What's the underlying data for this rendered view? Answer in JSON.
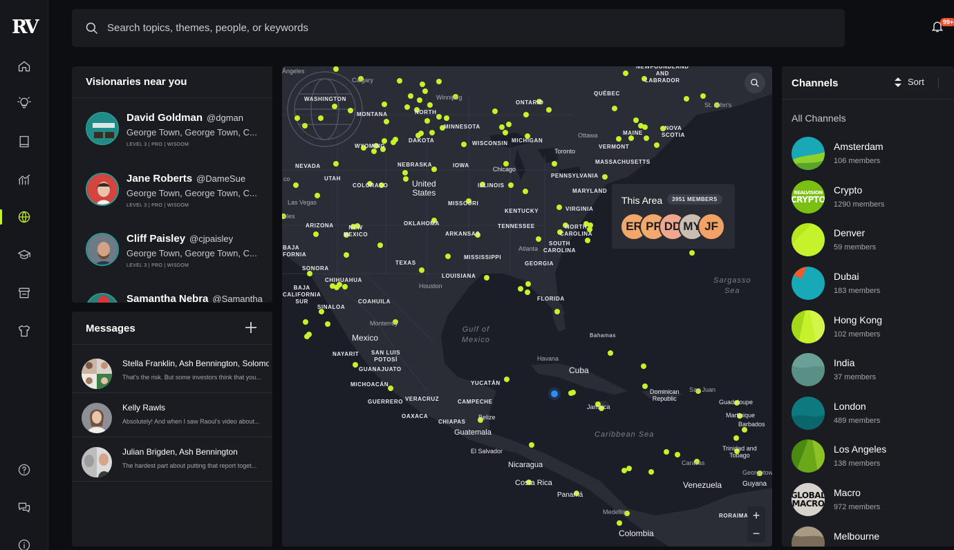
{
  "app": {
    "logo": "RV",
    "nav": [
      {
        "name": "nav-home",
        "icon": "home-icon"
      },
      {
        "name": "nav-ideas",
        "icon": "lightbulb-icon"
      },
      {
        "name": "nav-library",
        "icon": "book-icon"
      },
      {
        "name": "nav-charts",
        "icon": "chart-icon"
      },
      {
        "name": "nav-explore",
        "icon": "globe-icon",
        "active": true
      },
      {
        "name": "nav-academy",
        "icon": "graduation-cap-icon"
      },
      {
        "name": "nav-store",
        "icon": "store-icon"
      },
      {
        "name": "nav-merch",
        "icon": "tshirt-icon"
      },
      {
        "name": "nav-help",
        "icon": "question-icon"
      },
      {
        "name": "nav-chat",
        "icon": "chat-bubbles-icon"
      },
      {
        "name": "nav-info",
        "icon": "info-icon"
      }
    ],
    "accent": "#c5f22b"
  },
  "search": {
    "placeholder": "Search topics, themes, people, or keywords"
  },
  "notifications": {
    "badge": "99+"
  },
  "visionaries": {
    "title": "Visionaries near you",
    "people": [
      {
        "name": "David Goldman",
        "handle": "@dgman",
        "location": "George Town, George Town, C...",
        "meta": "LEVEL 3 | PRO | WISDOM"
      },
      {
        "name": "Jane Roberts",
        "handle": "@DameSue",
        "location": "George Town, George Town, C...",
        "meta": "LEVEL 3 | PRO | WISDOM"
      },
      {
        "name": "Cliff Paisley",
        "handle": "@cjpaisley",
        "location": "George Town, George Town, C...",
        "meta": "LEVEL 3 | PRO | WISDOM"
      },
      {
        "name": "Samantha Nebra",
        "handle": "@Samantha",
        "location": "",
        "meta": ""
      }
    ]
  },
  "messages": {
    "title": "Messages",
    "items": [
      {
        "names": "Stella Franklin, Ash Bennington, Solomon",
        "preview": "That's the risk. But some investors think that you..."
      },
      {
        "names": "Kelly Rawls",
        "preview": "Absolutely! And when I saw Raoul's video about..."
      },
      {
        "names": "Julian Brigden, Ash Bennington",
        "preview": "The hardest part about putting that report toget..."
      }
    ]
  },
  "map": {
    "area_card": {
      "title": "This Area",
      "members": "3951 MEMBERS",
      "initials": [
        "ER",
        "PF",
        "DD",
        "MY",
        "JF"
      ]
    },
    "labels": {
      "washington": "WASHINGTON",
      "montana": "MONTANA",
      "north_dakota": "NORTH",
      "dakota": "DAKOTA",
      "minnesota": "MINNESOTA",
      "wyoming": "WYOMING",
      "nevada": "NEVADA",
      "utah": "UTAH",
      "colorado": "COLORADO",
      "nebraska": "NEBRASKA",
      "iowa": "IOWA",
      "illinois": "ILLINOIS",
      "wisconsin": "WISCONSIN",
      "michigan": "MICHIGAN",
      "ontario": "ONTARIO",
      "quebec": "QUÉBEC",
      "newfoundland": "NEWFOUNDLAND\nAND\nLABRADOR",
      "maine": "MAINE",
      "nova_scotia": "NOVA\nSCOTIA",
      "vermont": "VERMONT",
      "massachusetts": "MASSACHUSETTS",
      "pennsylvania": "PENNSYLVANIA",
      "maryland": "MARYLAND",
      "virginia": "VIRGINIA",
      "kentucky": "KENTUCKY",
      "missouri": "MISSOURI",
      "oklahoma": "OKLAHOMA",
      "arizona": "ARIZONA",
      "new_mexico": "NEW\nMEXICO",
      "arkansas": "ARKANSAS",
      "tennessee": "TENNESSEE",
      "north_carolina": "NORTH\nCAROLINA",
      "south_carolina": "SOUTH\nCAROLINA",
      "georgia": "GEORGIA",
      "mississippi": "MISSISSIPPI",
      "texas": "TEXAS",
      "louisiana": "LOUISIANA",
      "florida": "FLORIDA",
      "sonora": "SONORA",
      "chihuahua": "CHIHUAHUA",
      "coahuila": "COAHUILA",
      "sinaloa": "SINALOA",
      "baja": "BAJA\nCALIFORNIA\nSUR",
      "baja_norte": "BAJA\nFORNIA",
      "nayarit": "NAYARIT",
      "slp": "SAN LUIS\nPOTOSÍ",
      "guanajuato": "GUANAJUATO",
      "michoacan": "MICHOACÁN",
      "guerrero": "GUERRERO",
      "veracruz": "VERACRUZ",
      "oaxaca": "OAXACA",
      "chiapas": "CHIAPAS",
      "campeche": "CAMPECHE",
      "yucatan": "YUCATÁN",
      "bahamas": "Bahamas",
      "roraima": "RORAIMA"
    },
    "cities": {
      "calgary": "Calgary",
      "winnipeg": "Winnipeg",
      "ottawa": "Ottawa",
      "toronto": "Toronto",
      "chicago": "Chicago",
      "las_vegas": "Las Vegas",
      "atlanta": "Atlanta",
      "houston": "Houston",
      "monterrey": "Monterrey",
      "havana": "Havana",
      "st_johns": "St. John's",
      "san_juan": "San Juan",
      "guadeloupe": "Guadeloupe",
      "martinique": "Martinique",
      "barbados": "Barbados",
      "trinidad": "Trinidad and\nTobago",
      "caracas": "Caracas",
      "georgetown": "Georgetown",
      "belize": "Belize",
      "el_salvador": "El Salvador",
      "jamaica": "Jamaica",
      "medellin": "Medellín",
      "angeles": "Ángeles",
      "co": "co",
      "eles": "eles"
    },
    "countries": {
      "united_states": "United\nStates",
      "mexico": "Mexico",
      "cuba": "Cuba",
      "guatemala": "Guatemala",
      "nicaragua": "Nicaragua",
      "costa_rica": "Costa Rica",
      "panama": "Panamá",
      "venezuela": "Venezuela",
      "colombia": "Colombia",
      "guyana": "Guyana",
      "dominican_republic": "Dominican\nRepublic"
    },
    "seas": {
      "gulf": "Gulf of\nMexico",
      "caribbean": "Caribbean Sea",
      "sargasso": "Sargasso\nSea"
    },
    "marker_color": "#c5f22b",
    "user_marker_color": "#2f8cf0",
    "zoom": {
      "in": "+",
      "out": "−"
    }
  },
  "channels": {
    "title": "Channels",
    "sort_label": "Sort",
    "section": "All Channels",
    "items": [
      {
        "name": "Amsterdam",
        "members": "106 members"
      },
      {
        "name": "Crypto",
        "members": "1290 members"
      },
      {
        "name": "Denver",
        "members": "59 members"
      },
      {
        "name": "Dubai",
        "members": "183 members"
      },
      {
        "name": "Hong Kong",
        "members": "102 members"
      },
      {
        "name": "India",
        "members": "37 members"
      },
      {
        "name": "London",
        "members": "489 members"
      },
      {
        "name": "Los Angeles",
        "members": "138 members"
      },
      {
        "name": "Macro",
        "members": "972 members"
      },
      {
        "name": "Melbourne",
        "members": ""
      }
    ],
    "logo_text": {
      "crypto_top": "REALVISION",
      "crypto_main": "CRYPTO",
      "macro_main": "GLOBAL\nMACRO"
    }
  }
}
